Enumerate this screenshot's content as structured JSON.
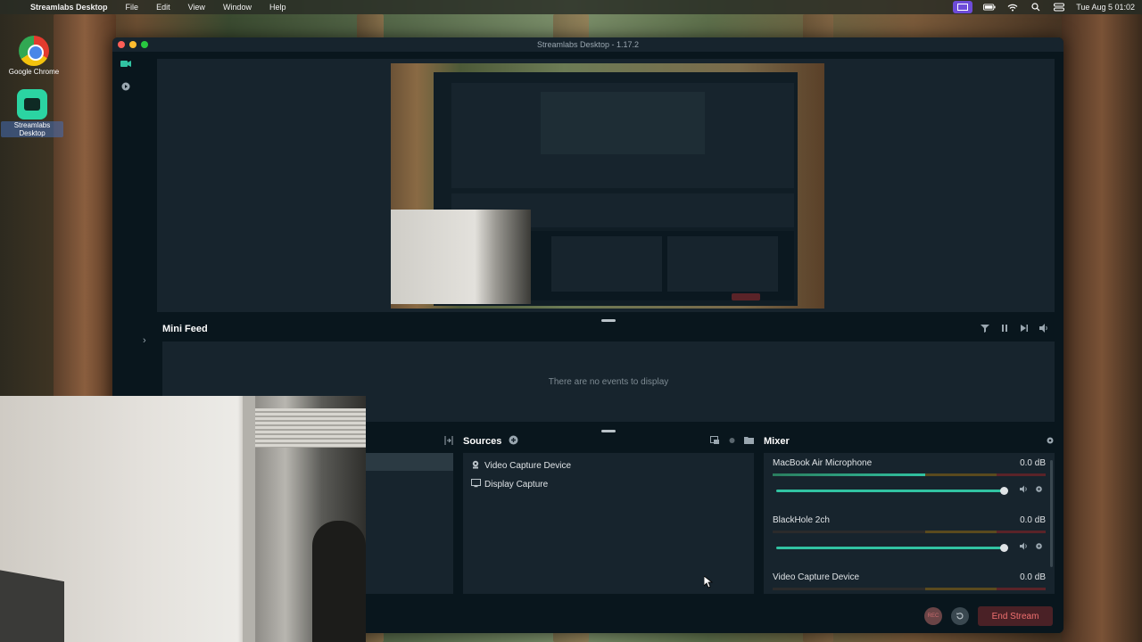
{
  "menubar": {
    "app_name": "Streamlabs Desktop",
    "menus": [
      "File",
      "Edit",
      "View",
      "Window",
      "Help"
    ],
    "clock": "Tue Aug 5  01:02"
  },
  "desktop": {
    "icons": [
      {
        "label": "Google Chrome"
      },
      {
        "label": "Streamlabs Desktop"
      }
    ]
  },
  "window": {
    "title": "Streamlabs Desktop - 1.17.2"
  },
  "mini_feed": {
    "title": "Mini Feed",
    "empty_text": "There are no events to display"
  },
  "sources": {
    "title": "Sources",
    "items": [
      {
        "label": "Video Capture Device",
        "icon": "camera-icon"
      },
      {
        "label": "Display Capture",
        "icon": "monitor-icon"
      }
    ]
  },
  "mixer": {
    "title": "Mixer",
    "items": [
      {
        "label": "MacBook Air Microphone",
        "db": "0.0 dB"
      },
      {
        "label": "BlackHole 2ch",
        "db": "0.0 dB"
      },
      {
        "label": "Video Capture Device",
        "db": "0.0 dB"
      }
    ]
  },
  "footer": {
    "rec_label": "REC",
    "end_stream": "End Stream"
  },
  "colors": {
    "accent": "#31c3a2",
    "background": "#09161d",
    "panel": "#17242d",
    "end_stream": "#f07070"
  }
}
